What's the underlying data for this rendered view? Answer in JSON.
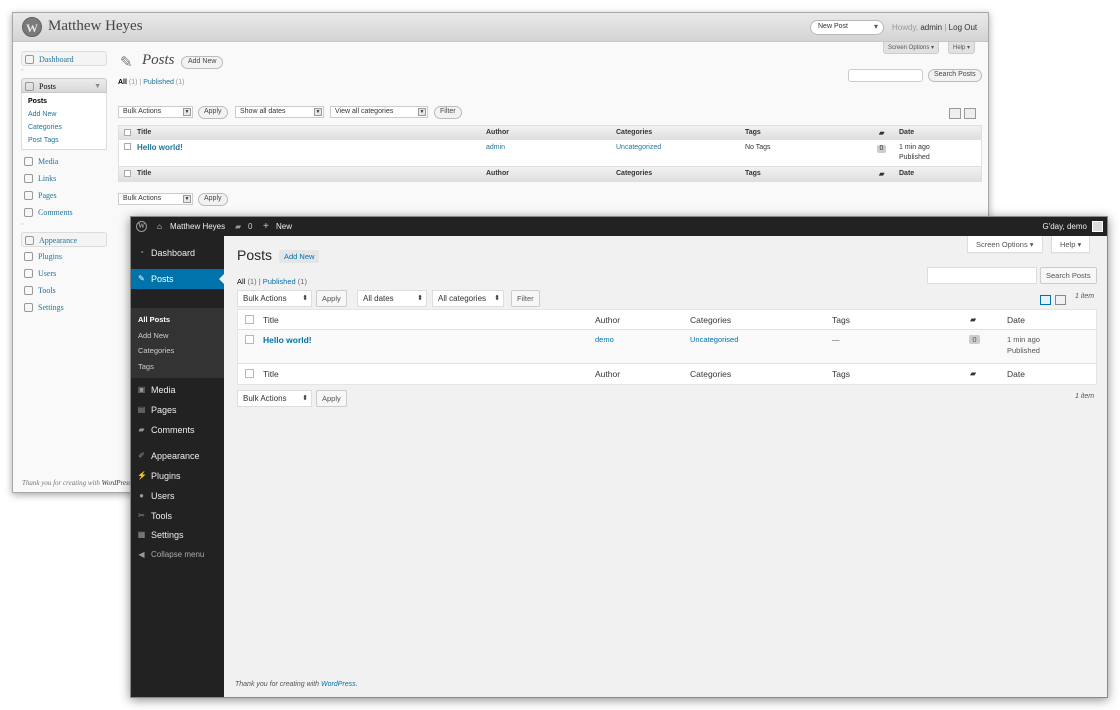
{
  "old": {
    "site_title": "Matthew Heyes",
    "favorite_action": "New Post",
    "howdy": "Howdy,",
    "user": "admin",
    "separator": "|",
    "logout": "Log Out",
    "screen_options": "Screen Options ▾",
    "help": "Help ▾",
    "menu": {
      "dashboard": "Dashboard",
      "posts": "Posts",
      "posts_sub": [
        "Posts",
        "Add New",
        "Categories",
        "Post Tags"
      ],
      "media": "Media",
      "links": "Links",
      "pages": "Pages",
      "comments": "Comments",
      "appearance": "Appearance",
      "plugins": "Plugins",
      "users": "Users",
      "tools": "Tools",
      "settings": "Settings"
    },
    "page_title": "Posts",
    "add_new": "Add New",
    "filters": {
      "all": "All",
      "all_count": "(1)",
      "sep": "|",
      "published": "Published",
      "published_count": "(1)"
    },
    "search_button": "Search Posts",
    "bulk_actions": "Bulk Actions",
    "apply": "Apply",
    "dates": "Show all dates",
    "categories_filter": "View all categories",
    "filter": "Filter",
    "columns": {
      "title": "Title",
      "author": "Author",
      "categories": "Categories",
      "tags": "Tags",
      "date": "Date"
    },
    "row": {
      "title": "Hello world!",
      "author": "admin",
      "category": "Uncategorized",
      "tags": "No Tags",
      "comments": "0",
      "date_line1": "1 min ago",
      "date_line2": "Published"
    },
    "footer_prefix": "Thank you for creating with",
    "footer_link": "WordPress"
  },
  "new": {
    "site_title": "Matthew Heyes",
    "comment_count": "0",
    "new_label": "New",
    "greeting": "G'day, demo",
    "menu": {
      "dashboard": "Dashboard",
      "posts": "Posts",
      "posts_sub": [
        "All Posts",
        "Add New",
        "Categories",
        "Tags"
      ],
      "media": "Media",
      "pages": "Pages",
      "comments": "Comments",
      "appearance": "Appearance",
      "plugins": "Plugins",
      "users": "Users",
      "tools": "Tools",
      "settings": "Settings",
      "collapse": "Collapse menu"
    },
    "page_title": "Posts",
    "add_new": "Add New",
    "screen_options": "Screen Options ▾",
    "help": "Help ▾",
    "filters": {
      "all": "All",
      "all_count": "(1)",
      "sep": "|",
      "published": "Published",
      "published_count": "(1)"
    },
    "search_button": "Search Posts",
    "bulk_actions": "Bulk Actions",
    "apply": "Apply",
    "dates": "All dates",
    "categories_filter": "All categories",
    "filter": "Filter",
    "item_count": "1 item",
    "columns": {
      "title": "Title",
      "author": "Author",
      "categories": "Categories",
      "tags": "Tags",
      "date": "Date"
    },
    "row": {
      "title": "Hello world!",
      "author": "demo",
      "category": "Uncategorised",
      "tags": "—",
      "comments": "0",
      "date_line1": "1 min ago",
      "date_line2": "Published"
    },
    "footer_prefix": "Thank you for creating with",
    "footer_link": "WordPress."
  }
}
